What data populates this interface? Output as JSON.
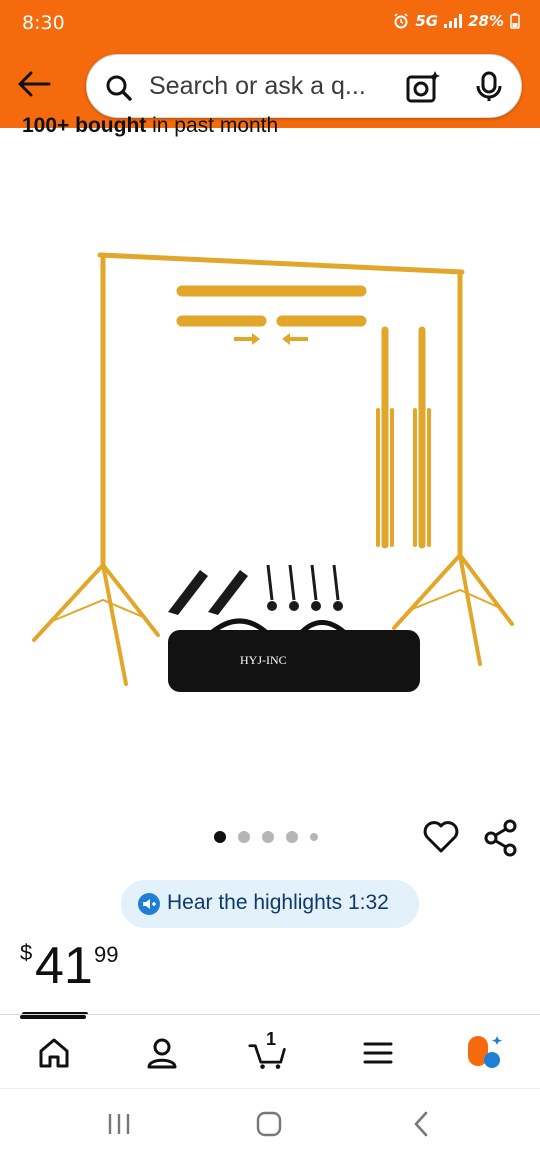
{
  "status_bar": {
    "time": "8:30",
    "network": "5G",
    "battery": "28%"
  },
  "header": {
    "back_icon": "arrow-left-icon",
    "search_placeholder": "Search or ask a q...",
    "search_icon": "search-icon",
    "camera_icon": "camera-sparkle-icon",
    "mic_icon": "microphone-icon",
    "background_color": "#f46a0d"
  },
  "product": {
    "bought_bold": "100+ bought",
    "bought_rest": " in past month",
    "bag_brand": "HYJ-INC",
    "image_colors": {
      "stand_gold": "#e2a72a",
      "bag_black": "#121212"
    }
  },
  "carousel": {
    "total_dots": 5,
    "active_index": 0
  },
  "actions": {
    "favorite_icon": "heart-icon",
    "share_icon": "share-icon"
  },
  "hear_highlights": {
    "label": "Hear the highlights 1:32",
    "icon": "speaker-plus-icon"
  },
  "price": {
    "symbol": "$",
    "whole": "41",
    "fraction": "99"
  },
  "bottom_nav": {
    "items": [
      {
        "name": "home",
        "icon": "home-icon"
      },
      {
        "name": "account",
        "icon": "person-icon"
      },
      {
        "name": "cart",
        "icon": "cart-icon",
        "count": "1"
      },
      {
        "name": "menu",
        "icon": "menu-icon"
      },
      {
        "name": "rufus",
        "icon": "rufus-chat-icon"
      }
    ]
  },
  "system_nav": {
    "recents_icon": "recents-icon",
    "home_icon": "circle-home-icon",
    "back_icon": "chevron-back-icon"
  }
}
